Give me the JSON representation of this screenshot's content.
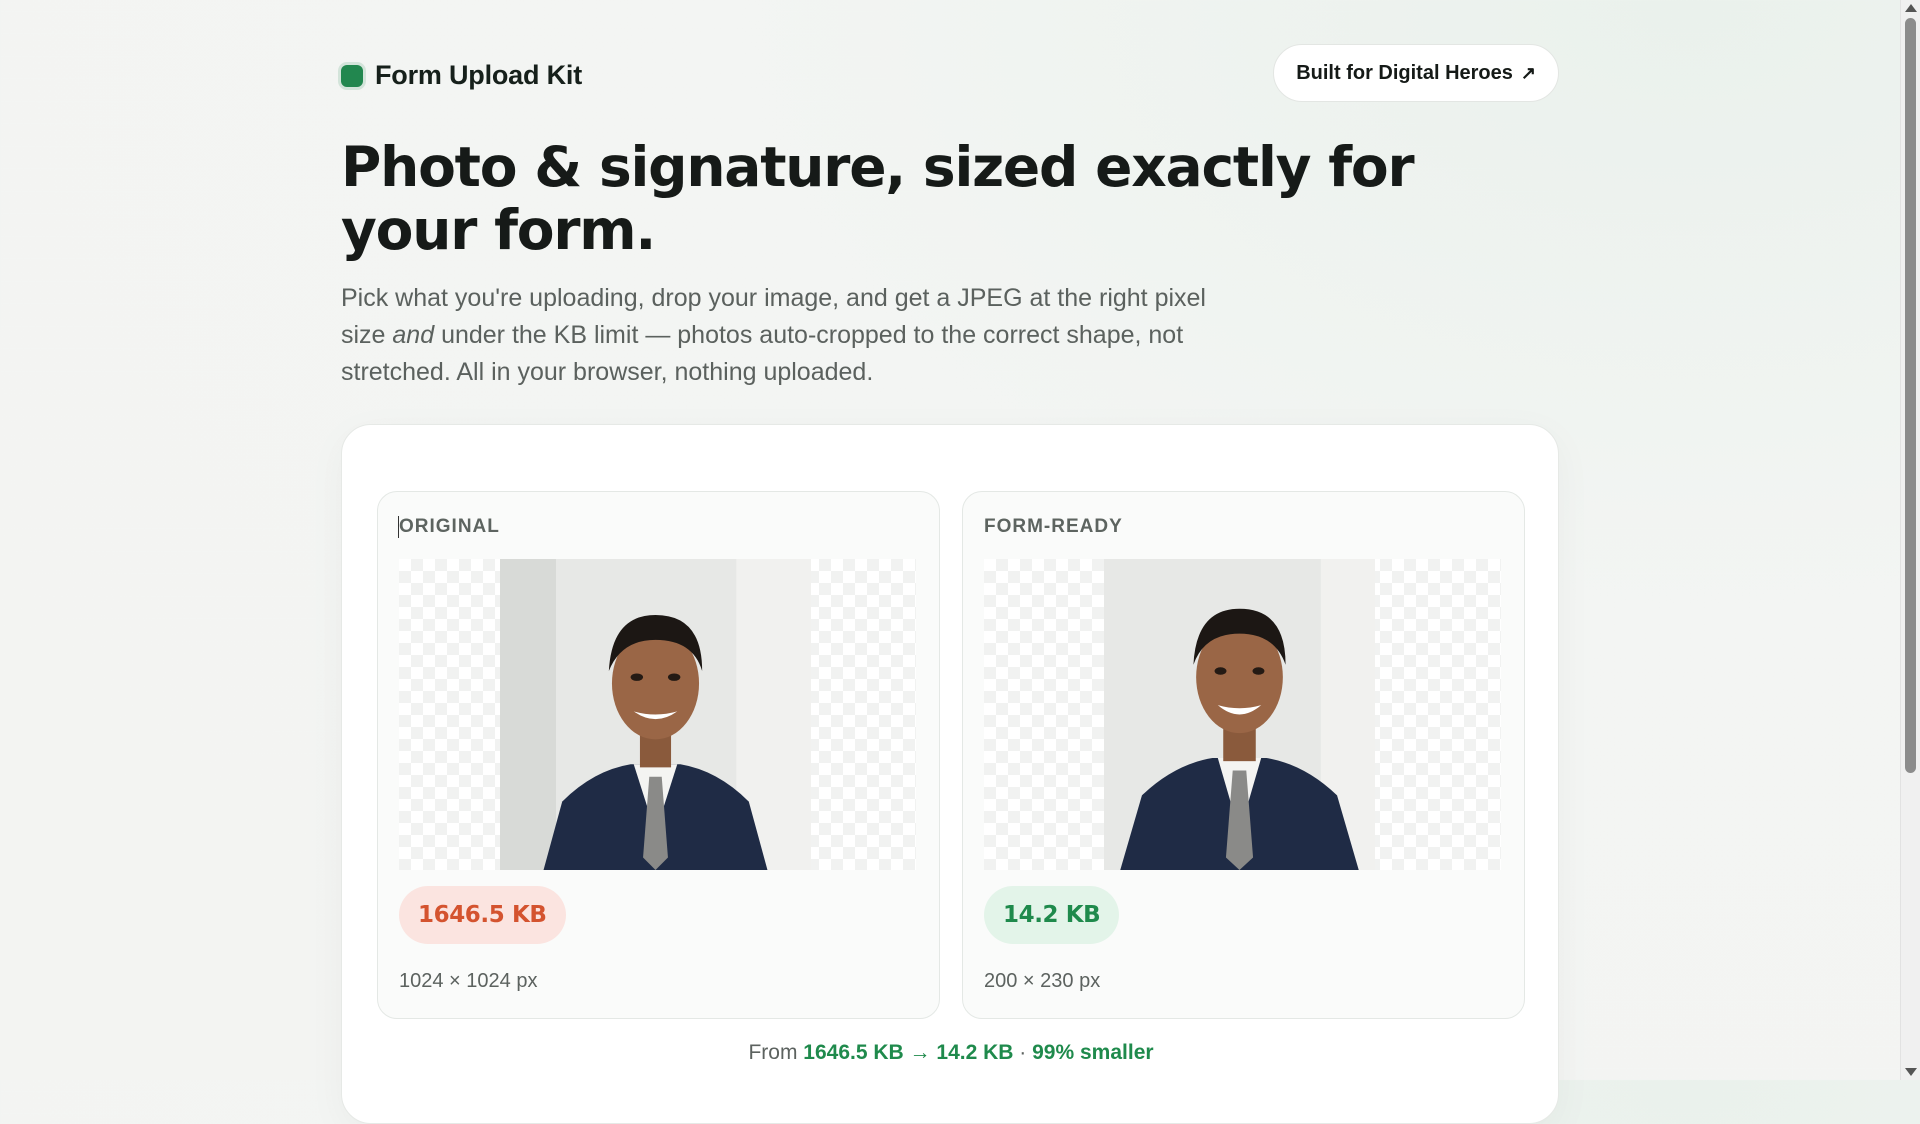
{
  "header": {
    "brand_name": "Form Upload Kit",
    "cta_label": "Built for Digital Heroes",
    "cta_arrow": "↗"
  },
  "hero": {
    "title": "Photo & signature, sized exactly for your form.",
    "lede_part1": "Pick what you're uploading, drop your image, and get a JPEG at the right pixel size ",
    "lede_emphasis": "and",
    "lede_part2": " under the KB limit — photos auto-cropped to the correct shape, not stretched. All in your browser, nothing uploaded."
  },
  "comparison": {
    "original": {
      "label": "ORIGINAL",
      "size": "1646.5 KB",
      "dimensions": "1024 × 1024 px"
    },
    "form_ready": {
      "label": "FORM-READY",
      "size": "14.2 KB",
      "dimensions": "200 × 230 px"
    },
    "summary_prefix": "From",
    "summary_from": "1646.5 KB",
    "summary_arrow": "→",
    "summary_to": "14.2 KB",
    "summary_sep": "·",
    "summary_reduction": "99% smaller"
  },
  "colors": {
    "accent": "#22874f",
    "original_badge": "#d4532f",
    "ready_badge": "#1f8a4c"
  }
}
